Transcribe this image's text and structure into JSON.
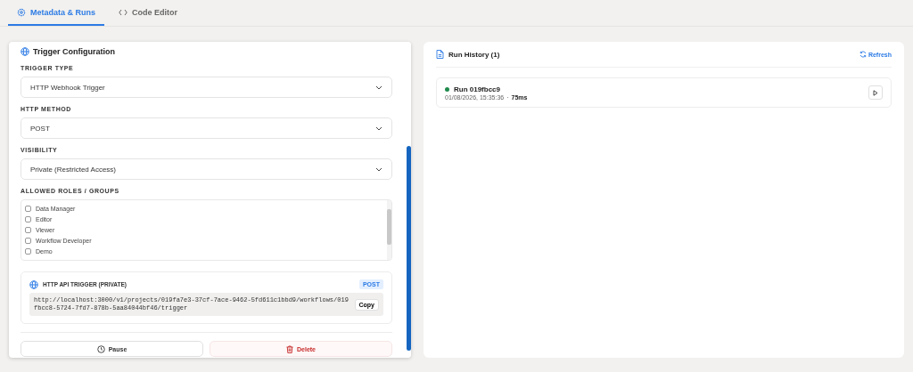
{
  "tabs": [
    {
      "label": "Metadata & Runs",
      "selected": true
    },
    {
      "label": "Code Editor",
      "selected": false
    }
  ],
  "trigger_config": {
    "title": "Trigger Configuration",
    "fields": [
      {
        "label": "TRIGGER TYPE",
        "value": "HTTP Webhook Trigger"
      },
      {
        "label": "HTTP METHOD",
        "value": "POST"
      },
      {
        "label": "VISIBILITY",
        "value": "Private (Restricted Access)"
      }
    ],
    "roles": {
      "label": "ALLOWED ROLES / GROUPS",
      "items": [
        {
          "label": "Data Manager",
          "checked": false
        },
        {
          "label": "Editor",
          "checked": false
        },
        {
          "label": "Viewer",
          "checked": false
        },
        {
          "label": "Workflow Developer",
          "checked": false
        },
        {
          "label": "Demo",
          "checked": false
        }
      ]
    },
    "api_trigger": {
      "title": "HTTP API TRIGGER (PRIVATE)",
      "method": "POST",
      "url": "http://localhost:3000/v1/projects/019fa7e3-37cf-7ace-9462-5fd611c1bbd9/workflows/019fbcc8-5724-7fd7-878b-5aa84044bf46/trigger",
      "copy": "Copy"
    },
    "buttons": [
      {
        "label": "Pause",
        "kind": "neutral"
      },
      {
        "label": "Delete",
        "kind": "danger"
      }
    ]
  },
  "run_history": {
    "title": "Run History (1)",
    "refresh": "Refresh",
    "runs": [
      {
        "name": "Run 019fbcc9",
        "color": "#1f8a4c",
        "date": "01/08/2026, 15:35:36",
        "separator": "·",
        "duration": "75ms"
      }
    ]
  }
}
